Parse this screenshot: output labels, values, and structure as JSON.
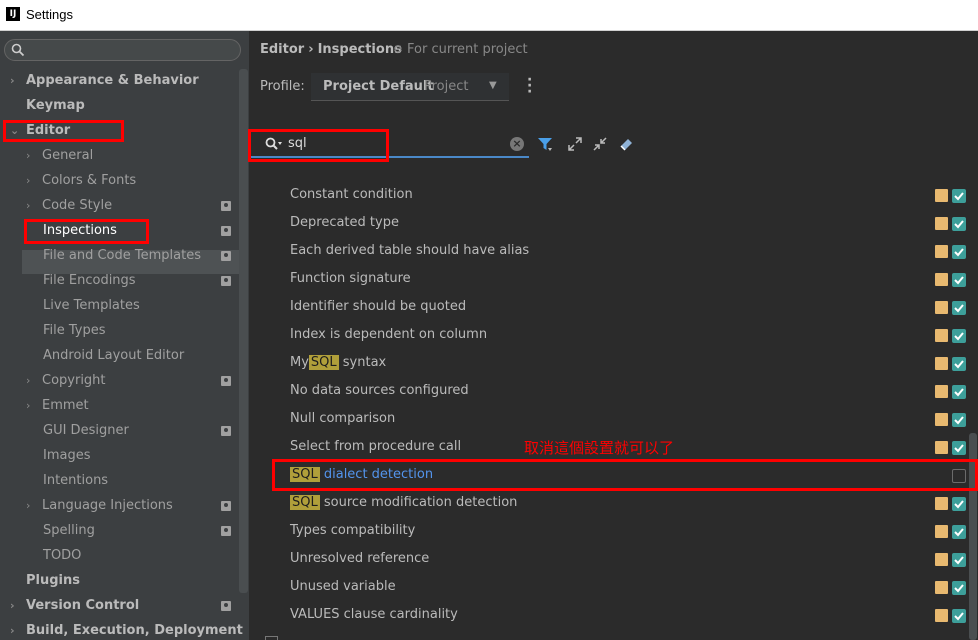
{
  "window": {
    "title": "Settings"
  },
  "sidebar": {
    "search_placeholder": "",
    "items": [
      {
        "label": "Appearance & Behavior"
      },
      {
        "label": "Keymap"
      },
      {
        "label": "Editor"
      },
      {
        "label": "General"
      },
      {
        "label": "Colors & Fonts"
      },
      {
        "label": "Code Style"
      },
      {
        "label": "Inspections"
      },
      {
        "label": "File and Code Templates"
      },
      {
        "label": "File Encodings"
      },
      {
        "label": "Live Templates"
      },
      {
        "label": "File Types"
      },
      {
        "label": "Android Layout Editor"
      },
      {
        "label": "Copyright"
      },
      {
        "label": "Emmet"
      },
      {
        "label": "GUI Designer"
      },
      {
        "label": "Images"
      },
      {
        "label": "Intentions"
      },
      {
        "label": "Language Injections"
      },
      {
        "label": "Spelling"
      },
      {
        "label": "TODO"
      },
      {
        "label": "Plugins"
      },
      {
        "label": "Version Control"
      },
      {
        "label": "Build, Execution, Deployment"
      }
    ]
  },
  "header": {
    "breadcrumb": [
      "Editor",
      "›",
      "Inspections"
    ],
    "scope": "For current project"
  },
  "profile": {
    "label": "Profile:",
    "value": "Project Default",
    "scope": "Project"
  },
  "filter": {
    "value": "sql"
  },
  "inspections": [
    {
      "label": "Constant condition"
    },
    {
      "label": "Deprecated type"
    },
    {
      "label": "Each derived table should have alias"
    },
    {
      "label": "Function signature"
    },
    {
      "label": "Identifier should be quoted"
    },
    {
      "label": "Index is dependent on column"
    },
    {
      "prefix": "My",
      "highlight": "SQL",
      "suffix": " syntax"
    },
    {
      "label": "No data sources configured"
    },
    {
      "label": "Null comparison"
    },
    {
      "label": "Select from procedure call"
    },
    {
      "highlight": "SQL",
      "suffix": " dialect detection",
      "enabled": false
    },
    {
      "highlight": "SQL",
      "suffix": " source modification detection"
    },
    {
      "label": "Types compatibility"
    },
    {
      "label": "Unresolved reference"
    },
    {
      "label": "Unused variable"
    },
    {
      "label": "VALUES clause cardinality"
    }
  ],
  "annotation": "取消這個設置就可以了",
  "colors": {
    "accent": "#4a88c7",
    "checked": "#3d9f9a",
    "severity": "#e8b970",
    "highlight": "#b09f3a",
    "annotation": "#ff0000"
  }
}
